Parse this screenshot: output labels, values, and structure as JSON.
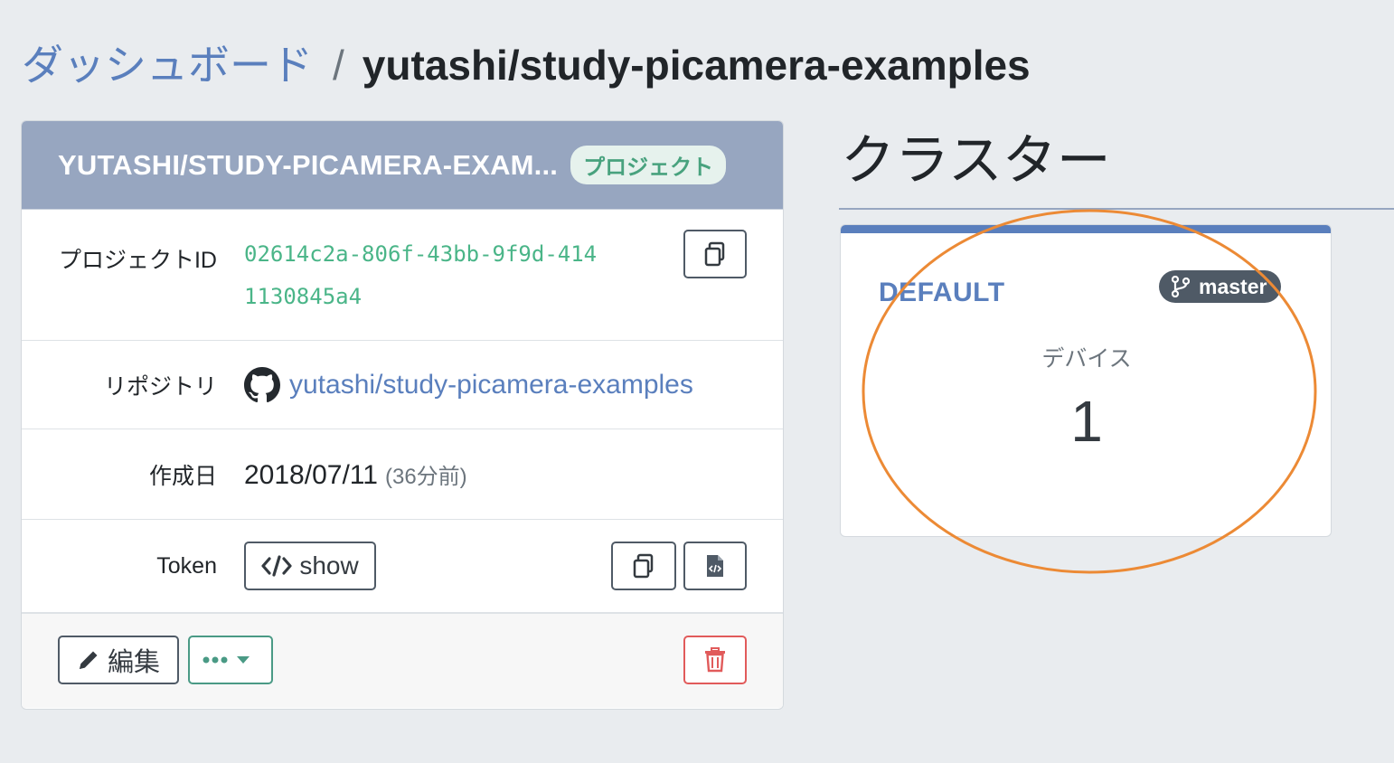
{
  "breadcrumb": {
    "parent": "ダッシュボード",
    "separator": "/",
    "current": "yutashi/study-picamera-examples"
  },
  "project": {
    "title": "YUTASHI/STUDY-PICAMERA-EXAM...",
    "badge": "プロジェクト",
    "rows": {
      "id_label": "プロジェクトID",
      "id_value": "02614c2a-806f-43bb-9f9d-4141130845a4",
      "repo_label": "リポジトリ",
      "repo_value": "yutashi/study-picamera-examples",
      "date_label": "作成日",
      "date_value": "2018/07/11",
      "date_relative": "(36分前)",
      "token_label": "Token",
      "token_show": "show"
    },
    "footer": {
      "edit_label": "編集"
    }
  },
  "cluster_section": {
    "heading": "クラスター",
    "card": {
      "name": "DEFAULT",
      "branch": "master",
      "device_label": "デバイス",
      "device_count": "1"
    }
  },
  "colors": {
    "accent": "#5a7fbd",
    "header_bg": "#97a6c0",
    "id_green": "#4ab588",
    "highlight": "#ec8a35",
    "delete_red": "#e15b5b"
  },
  "icons": [
    "copy-icon",
    "code-icon",
    "file-code-icon",
    "pencil-icon",
    "ellipsis-icon",
    "caret-down-icon",
    "trash-icon",
    "github-icon",
    "code-branch-icon"
  ]
}
